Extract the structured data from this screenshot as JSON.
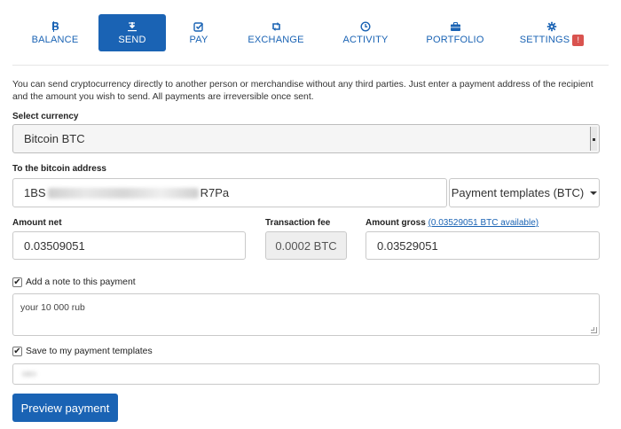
{
  "nav": {
    "items": [
      {
        "label": "BALANCE",
        "icon": "bitcoin-icon"
      },
      {
        "label": "SEND",
        "icon": "send-icon"
      },
      {
        "label": "PAY",
        "icon": "checkbox-icon"
      },
      {
        "label": "EXCHANGE",
        "icon": "retweet-icon"
      },
      {
        "label": "ACTIVITY",
        "icon": "clock-icon"
      },
      {
        "label": "PORTFOLIO",
        "icon": "briefcase-icon"
      },
      {
        "label": "SETTINGS",
        "icon": "gear-icon"
      }
    ],
    "active": "SEND",
    "settings_badge": "!",
    "colors": {
      "accent": "#1a63b4",
      "badge": "#d9534f"
    }
  },
  "intro": "You can send cryptocurrency directly to another person or merchandise without any third parties. Just enter a payment address of the recipient and the amount you wish to send. All payments are irreversible once sent.",
  "currency": {
    "label": "Select currency",
    "value": "Bitcoin BTC"
  },
  "address": {
    "label": "To the bitcoin address",
    "value_prefix": "1BS",
    "value_suffix": "R7Pa",
    "templates_button": "Payment templates (BTC)"
  },
  "amounts": {
    "net_label": "Amount net",
    "net_value": "0.03509051",
    "fee_label": "Transaction fee",
    "fee_value": "0.0002 BTC",
    "gross_label": "Amount gross",
    "available_link": "(0.03529051 BTC available)",
    "gross_value": "0.03529051"
  },
  "note": {
    "label": "Add a note to this payment",
    "checked": true,
    "value": "your 10 000 rub"
  },
  "save_template": {
    "label": "Save to my payment templates",
    "checked": true
  },
  "preview_button": "Preview payment"
}
